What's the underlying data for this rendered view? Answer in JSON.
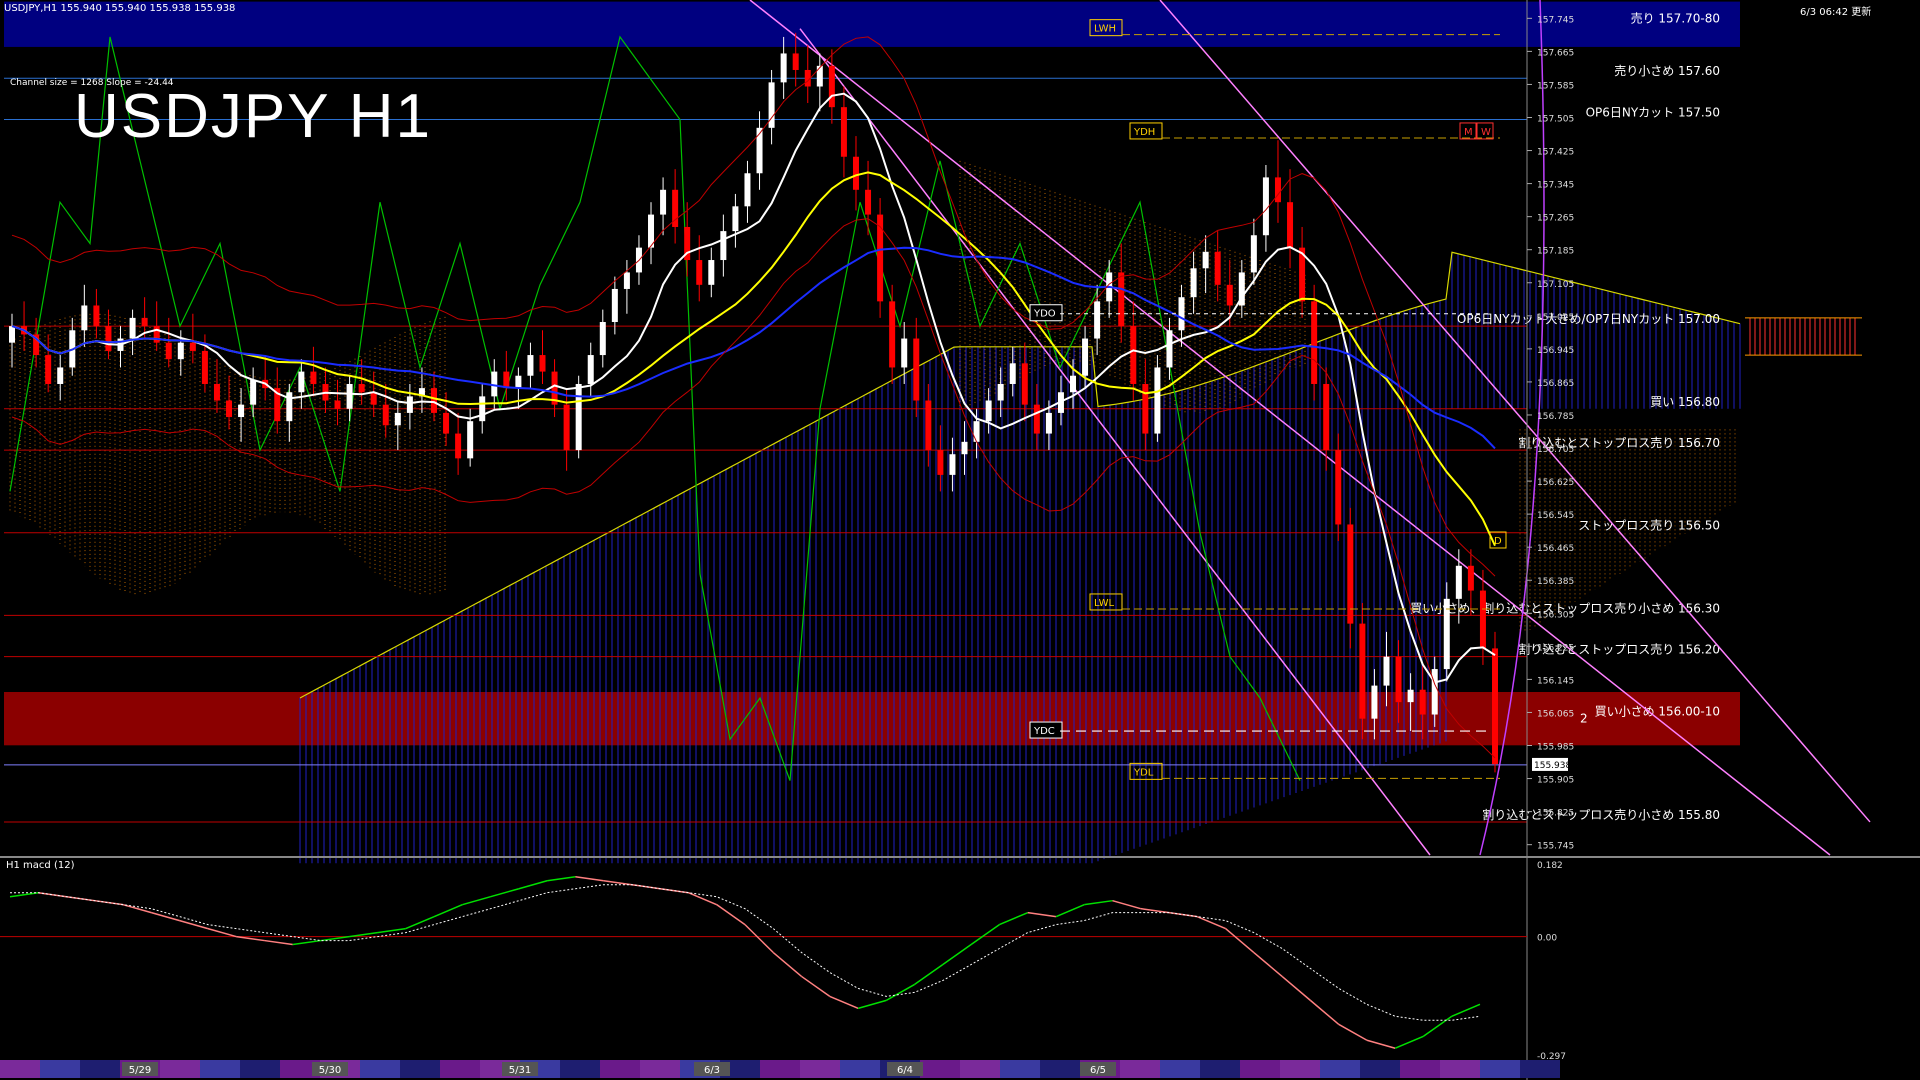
{
  "header": {
    "symbol_line": "USDJPY,H1  155.940 155.940 155.938 155.938",
    "datetime": "6/3 06:42 更新"
  },
  "title": "USDJPY H1",
  "channel_info": "Channel size = 1268 Slope = -24.44",
  "macd_label": "H1  macd (12)",
  "colors": {
    "background": "#000000",
    "sell_zone": "#000080",
    "buy_zone": "#8b0000",
    "bull_candle": "#ffffff",
    "bear_candle": "#ff0000",
    "ma_white": "#ffffff",
    "ma_yellow": "#ffff00",
    "ma_blue": "#1a2cff",
    "chikou_green": "#00c000",
    "cloud_blue": "#2020c0",
    "cloud_orange": "#ff8c00",
    "channel_magenta": "#ff80ff",
    "macd_green": "#00e000",
    "macd_pink": "#ff8080"
  },
  "chart_data": {
    "type": "candlestick",
    "symbol": "USDJPY",
    "timeframe": "H1",
    "ylim": [
      155.72,
      157.77
    ],
    "price_ticks": [
      "157.745",
      "157.665",
      "157.585",
      "157.505",
      "157.425",
      "157.345",
      "157.265",
      "157.185",
      "157.105",
      "157.025",
      "156.945",
      "156.865",
      "156.785",
      "156.705",
      "156.625",
      "156.545",
      "156.465",
      "156.385",
      "156.305",
      "156.225",
      "156.145",
      "156.065",
      "155.985",
      "155.905",
      "155.825",
      "155.745"
    ],
    "current_price": "155.938",
    "date_labels": [
      "5/29",
      "5/30",
      "5/31",
      "6/3",
      "6/4",
      "6/5"
    ],
    "levels": [
      {
        "label": "売り 157.70-80",
        "value": 157.75,
        "kind": "sell-zone",
        "lo": 157.7,
        "hi": 157.8
      },
      {
        "label": "売り小さめ 157.60",
        "value": 157.6,
        "kind": "line"
      },
      {
        "label": "OP6日NYカット 157.50",
        "value": 157.5,
        "kind": "line"
      },
      {
        "label": "OP6日NYカット大きめ/OP7日NYカット 157.00",
        "value": 157.0,
        "kind": "line"
      },
      {
        "label": "買い 156.80",
        "value": 156.8,
        "kind": "line"
      },
      {
        "label": "割り込むとストップロス売り 156.70",
        "value": 156.7,
        "kind": "line"
      },
      {
        "label": "ストップロス売り 156.50",
        "value": 156.5,
        "kind": "line"
      },
      {
        "label": "買い小さめ、割り込むとストップロス売り小さめ 156.30",
        "value": 156.3,
        "kind": "line"
      },
      {
        "label": "割り込むとストップロス売り 156.20",
        "value": 156.2,
        "kind": "line"
      },
      {
        "label": "買い小さめ 156.00-10",
        "value": 156.05,
        "kind": "buy-zone",
        "lo": 156.0,
        "hi": 156.1
      },
      {
        "label": "割り込むとストップロス売り小さめ 155.80",
        "value": 155.8,
        "kind": "line"
      }
    ],
    "markers": [
      {
        "label": "LWH",
        "value": 157.72
      },
      {
        "label": "YDH",
        "value": 157.47
      },
      {
        "label": "YDO",
        "value": 157.03
      },
      {
        "label": "LWL",
        "value": 156.33
      },
      {
        "label": "YDC",
        "value": 156.02
      },
      {
        "label": "YDL",
        "value": 155.92
      },
      {
        "label": "M",
        "value": 157.47
      },
      {
        "label": "W",
        "value": 157.47
      },
      {
        "label": "D",
        "value": 156.48
      },
      {
        "label": "2",
        "value": 156.05
      }
    ],
    "ohlc": [
      [
        156.96,
        157.03,
        156.9,
        157.0
      ],
      [
        157.0,
        157.06,
        156.94,
        156.98
      ],
      [
        156.98,
        157.02,
        156.9,
        156.93
      ],
      [
        156.93,
        156.98,
        156.84,
        156.86
      ],
      [
        156.86,
        156.93,
        156.82,
        156.9
      ],
      [
        156.9,
        157.02,
        156.88,
        156.99
      ],
      [
        156.99,
        157.1,
        156.95,
        157.05
      ],
      [
        157.05,
        157.09,
        156.97,
        157.0
      ],
      [
        157.0,
        157.04,
        156.92,
        156.94
      ],
      [
        156.94,
        157.0,
        156.9,
        156.97
      ],
      [
        156.97,
        157.04,
        156.93,
        157.02
      ],
      [
        157.02,
        157.07,
        156.97,
        157.0
      ],
      [
        157.0,
        157.06,
        156.94,
        156.96
      ],
      [
        156.96,
        157.02,
        156.9,
        156.92
      ],
      [
        156.92,
        156.99,
        156.88,
        156.96
      ],
      [
        156.96,
        157.03,
        156.91,
        156.94
      ],
      [
        156.94,
        156.98,
        156.84,
        156.86
      ],
      [
        156.86,
        156.92,
        156.79,
        156.82
      ],
      [
        156.82,
        156.88,
        156.75,
        156.78
      ],
      [
        156.78,
        156.85,
        156.72,
        156.81
      ],
      [
        156.81,
        156.9,
        156.78,
        156.87
      ],
      [
        156.87,
        156.93,
        156.82,
        156.85
      ],
      [
        156.85,
        156.9,
        156.74,
        156.77
      ],
      [
        156.77,
        156.86,
        156.72,
        156.84
      ],
      [
        156.84,
        156.92,
        156.8,
        156.89
      ],
      [
        156.89,
        156.95,
        156.83,
        156.86
      ],
      [
        156.86,
        156.9,
        156.79,
        156.82
      ],
      [
        156.82,
        156.87,
        156.76,
        156.8
      ],
      [
        156.8,
        156.88,
        156.77,
        156.86
      ],
      [
        156.86,
        156.92,
        156.81,
        156.84
      ],
      [
        156.84,
        156.89,
        156.78,
        156.81
      ],
      [
        156.81,
        156.86,
        156.73,
        156.76
      ],
      [
        156.76,
        156.82,
        156.7,
        156.79
      ],
      [
        156.79,
        156.86,
        156.75,
        156.83
      ],
      [
        156.83,
        156.9,
        156.79,
        156.85
      ],
      [
        156.85,
        156.89,
        156.77,
        156.79
      ],
      [
        156.79,
        156.84,
        156.71,
        156.74
      ],
      [
        156.74,
        156.79,
        156.64,
        156.68
      ],
      [
        156.68,
        156.8,
        156.66,
        156.77
      ],
      [
        156.77,
        156.86,
        156.74,
        156.83
      ],
      [
        156.83,
        156.92,
        156.8,
        156.89
      ],
      [
        156.89,
        156.94,
        156.82,
        156.85
      ],
      [
        156.85,
        156.9,
        156.8,
        156.88
      ],
      [
        156.88,
        156.96,
        156.85,
        156.93
      ],
      [
        156.93,
        156.99,
        156.86,
        156.89
      ],
      [
        156.89,
        156.92,
        156.78,
        156.81
      ],
      [
        156.81,
        156.85,
        156.65,
        156.7
      ],
      [
        156.7,
        156.88,
        156.68,
        156.86
      ],
      [
        156.86,
        156.96,
        156.83,
        156.93
      ],
      [
        156.93,
        157.04,
        156.9,
        157.01
      ],
      [
        157.01,
        157.12,
        156.98,
        157.09
      ],
      [
        157.09,
        157.16,
        157.03,
        157.13
      ],
      [
        157.13,
        157.22,
        157.1,
        157.19
      ],
      [
        157.19,
        157.3,
        157.15,
        157.27
      ],
      [
        157.27,
        157.36,
        157.22,
        157.33
      ],
      [
        157.33,
        157.38,
        157.2,
        157.24
      ],
      [
        157.24,
        157.3,
        157.12,
        157.16
      ],
      [
        157.16,
        157.22,
        157.06,
        157.1
      ],
      [
        157.1,
        157.19,
        157.07,
        157.16
      ],
      [
        157.16,
        157.27,
        157.12,
        157.23
      ],
      [
        157.23,
        157.32,
        157.19,
        157.29
      ],
      [
        157.29,
        157.4,
        157.25,
        157.37
      ],
      [
        157.37,
        157.52,
        157.33,
        157.48
      ],
      [
        157.48,
        157.62,
        157.44,
        157.59
      ],
      [
        157.59,
        157.7,
        157.55,
        157.66
      ],
      [
        157.66,
        157.71,
        157.58,
        157.62
      ],
      [
        157.62,
        157.68,
        157.54,
        157.58
      ],
      [
        157.58,
        157.66,
        157.52,
        157.63
      ],
      [
        157.63,
        157.67,
        157.49,
        157.53
      ],
      [
        157.53,
        157.58,
        157.36,
        157.41
      ],
      [
        157.41,
        157.46,
        157.28,
        157.33
      ],
      [
        157.33,
        157.4,
        157.22,
        157.27
      ],
      [
        157.27,
        157.31,
        157.02,
        157.06
      ],
      [
        157.06,
        157.1,
        156.86,
        156.9
      ],
      [
        156.9,
        157.01,
        156.86,
        156.97
      ],
      [
        156.97,
        157.02,
        156.78,
        156.82
      ],
      [
        156.82,
        156.86,
        156.66,
        156.7
      ],
      [
        156.7,
        156.76,
        156.6,
        156.64
      ],
      [
        156.64,
        156.73,
        156.6,
        156.69
      ],
      [
        156.69,
        156.77,
        156.64,
        156.72
      ],
      [
        156.72,
        156.8,
        156.68,
        156.77
      ],
      [
        156.77,
        156.85,
        156.74,
        156.82
      ],
      [
        156.82,
        156.9,
        156.78,
        156.86
      ],
      [
        156.86,
        156.95,
        156.83,
        156.91
      ],
      [
        156.91,
        156.96,
        156.77,
        156.81
      ],
      [
        156.81,
        156.86,
        156.7,
        156.74
      ],
      [
        156.74,
        156.82,
        156.7,
        156.79
      ],
      [
        156.79,
        156.88,
        156.76,
        156.84
      ],
      [
        156.84,
        156.92,
        156.8,
        156.88
      ],
      [
        156.88,
        157.0,
        156.85,
        156.97
      ],
      [
        156.97,
        157.1,
        156.93,
        157.06
      ],
      [
        157.06,
        157.16,
        157.02,
        157.13
      ],
      [
        157.13,
        157.2,
        156.96,
        157.0
      ],
      [
        157.0,
        157.06,
        156.82,
        156.86
      ],
      [
        156.86,
        156.92,
        156.7,
        156.74
      ],
      [
        156.74,
        156.93,
        156.72,
        156.9
      ],
      [
        156.9,
        157.02,
        156.87,
        156.99
      ],
      [
        156.99,
        157.1,
        156.95,
        157.07
      ],
      [
        157.07,
        157.18,
        157.03,
        157.14
      ],
      [
        157.14,
        157.22,
        157.08,
        157.18
      ],
      [
        157.18,
        157.23,
        157.06,
        157.1
      ],
      [
        157.1,
        157.16,
        157.0,
        157.05
      ],
      [
        157.05,
        157.16,
        157.02,
        157.13
      ],
      [
        157.13,
        157.26,
        157.1,
        157.22
      ],
      [
        157.22,
        157.39,
        157.18,
        157.36
      ],
      [
        157.36,
        157.45,
        157.25,
        157.3
      ],
      [
        157.3,
        157.38,
        157.14,
        157.19
      ],
      [
        157.19,
        157.24,
        157.02,
        157.06
      ],
      [
        157.06,
        157.1,
        156.82,
        156.86
      ],
      [
        156.86,
        156.9,
        156.65,
        156.7
      ],
      [
        156.7,
        156.74,
        156.48,
        156.52
      ],
      [
        156.52,
        156.56,
        156.22,
        156.28
      ],
      [
        156.28,
        156.33,
        156.0,
        156.05
      ],
      [
        156.05,
        156.17,
        156.0,
        156.13
      ],
      [
        156.13,
        156.26,
        156.08,
        156.2
      ],
      [
        156.2,
        156.24,
        156.04,
        156.09
      ],
      [
        156.09,
        156.16,
        156.02,
        156.12
      ],
      [
        156.12,
        156.18,
        156.0,
        156.06
      ],
      [
        156.06,
        156.2,
        156.03,
        156.17
      ],
      [
        156.17,
        156.38,
        156.14,
        156.34
      ],
      [
        156.34,
        156.46,
        156.28,
        156.42
      ],
      [
        156.42,
        156.46,
        156.3,
        156.36
      ],
      [
        156.36,
        156.41,
        156.18,
        156.22
      ],
      [
        156.22,
        156.26,
        155.92,
        155.94
      ]
    ],
    "macd": {
      "ylim": [
        -0.297,
        0.182
      ],
      "ticks": [
        "0.182",
        "0.00",
        "-0.297"
      ],
      "main_green_pink": [
        0.1,
        0.11,
        0.1,
        0.09,
        0.08,
        0.06,
        0.04,
        0.02,
        0.0,
        -0.01,
        -0.02,
        -0.01,
        0.0,
        0.01,
        0.02,
        0.05,
        0.08,
        0.1,
        0.12,
        0.14,
        0.15,
        0.14,
        0.13,
        0.12,
        0.11,
        0.08,
        0.03,
        -0.04,
        -0.1,
        -0.15,
        -0.18,
        -0.16,
        -0.12,
        -0.07,
        -0.02,
        0.03,
        0.06,
        0.05,
        0.08,
        0.09,
        0.07,
        0.06,
        0.05,
        0.02,
        -0.04,
        -0.1,
        -0.16,
        -0.22,
        -0.26,
        -0.28,
        -0.25,
        -0.2,
        -0.17
      ],
      "signal_dotted": [
        0.11,
        0.11,
        0.1,
        0.09,
        0.08,
        0.07,
        0.05,
        0.03,
        0.02,
        0.01,
        0.0,
        -0.01,
        -0.01,
        0.0,
        0.01,
        0.03,
        0.05,
        0.07,
        0.09,
        0.11,
        0.12,
        0.13,
        0.13,
        0.12,
        0.11,
        0.1,
        0.07,
        0.02,
        -0.04,
        -0.09,
        -0.13,
        -0.15,
        -0.14,
        -0.11,
        -0.07,
        -0.03,
        0.01,
        0.03,
        0.04,
        0.06,
        0.06,
        0.06,
        0.05,
        0.04,
        0.01,
        -0.03,
        -0.08,
        -0.13,
        -0.17,
        -0.2,
        -0.21,
        -0.21,
        -0.2
      ]
    }
  }
}
